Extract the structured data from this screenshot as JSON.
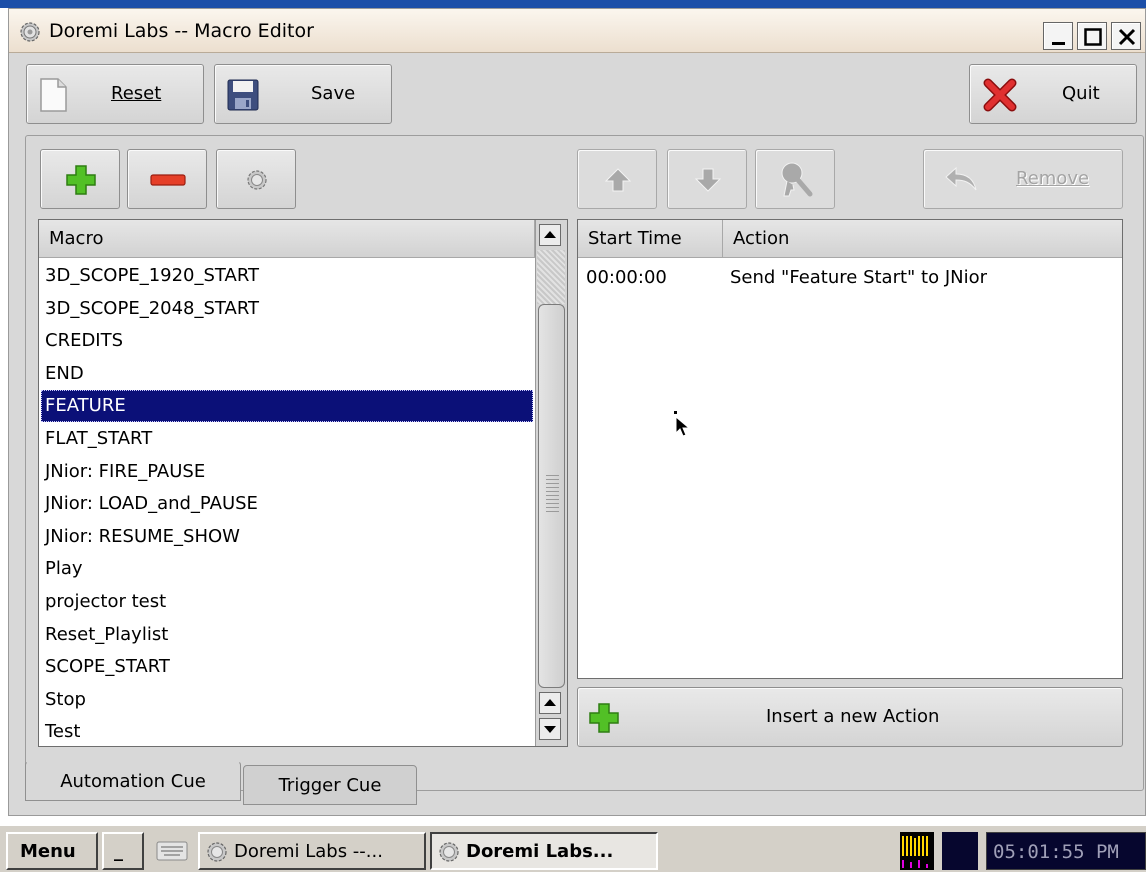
{
  "window": {
    "title": "Doremi Labs -- Macro Editor"
  },
  "toolbar": {
    "reset_label": "Reset",
    "save_label": "Save",
    "quit_label": "Quit"
  },
  "actions_toolbar": {
    "remove_label": "Remove"
  },
  "macro_list": {
    "header": "Macro",
    "items": [
      "3D_SCOPE_1920_START",
      "3D_SCOPE_2048_START",
      "CREDITS",
      "END",
      "FEATURE",
      "FLAT_START",
      "JNior: FIRE_PAUSE",
      "JNior: LOAD_and_PAUSE",
      "JNior: RESUME_SHOW",
      "Play",
      "projector test",
      "Reset_Playlist",
      "SCOPE_START",
      "Stop",
      "Test"
    ],
    "selected": "FEATURE"
  },
  "actions_table": {
    "headers": [
      "Start Time",
      "Action"
    ],
    "rows": [
      {
        "start_time": "00:00:00",
        "action": "Send \"Feature Start\" to JNior"
      }
    ]
  },
  "insert_action_label": "Insert a new Action",
  "tabs": [
    "Automation Cue",
    "Trigger Cue"
  ],
  "taskbar": {
    "menu_label": "Menu",
    "min_label": "_",
    "task1_label": "Doremi Labs --...",
    "task2_label": "Doremi Labs...",
    "clock": "05:01:55 PM"
  },
  "colors": {
    "selection": "#0b1078",
    "title_bar": "#f4ece0",
    "accent_blue": "#1c4fa8",
    "clock_bg": "#06062e"
  },
  "icons": [
    "gear-icon",
    "document-icon",
    "floppy-disk-icon",
    "red-x-icon",
    "plus-icon",
    "minus-icon",
    "arrow-up-icon",
    "arrow-down-icon",
    "key-icon",
    "undo-arrow-icon",
    "keyboard-icon",
    "cpu-meter-icon"
  ]
}
